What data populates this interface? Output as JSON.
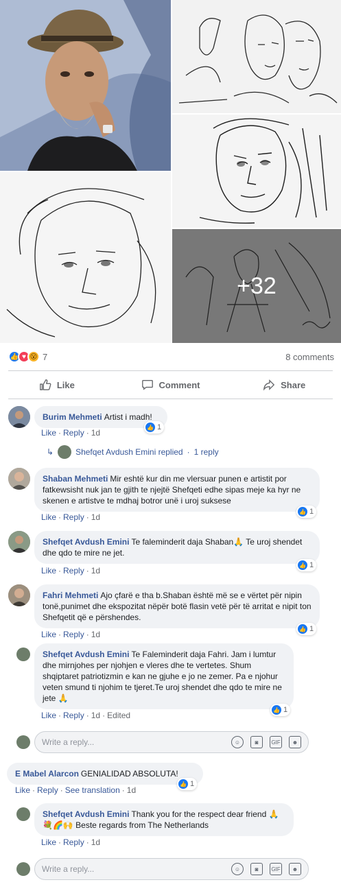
{
  "grid": {
    "more_count": "+32"
  },
  "reactions": {
    "count": "7",
    "comments": "8 comments",
    "icons": [
      "like",
      "love",
      "wow"
    ]
  },
  "actions": {
    "like": "Like",
    "comment": "Comment",
    "share": "Share"
  },
  "comments": [
    {
      "author": "Burim Mehmeti",
      "text": "Artist i madh!",
      "like": "Like",
      "reply": "Reply",
      "time": "1d",
      "reactions": "1"
    },
    {
      "replied_by": "Shefqet Avdush Emini replied",
      "replies": "1 reply"
    },
    {
      "author": "Shaban Mehmeti",
      "text": "Mir eshtë kur din me vlersuar punen e artistit por fatkewsisht nuk jan te gjith te njejtë Shefqeti edhe sipas meje ka hyr ne skenen e artistve te mdhaj botror unë i uroj suksese",
      "like": "Like",
      "reply": "Reply",
      "time": "1d",
      "reactions": "1"
    },
    {
      "author": "Shefqet Avdush Emini",
      "text": "Te faleminderit daja Shaban🙏 Te uroj shendet dhe qdo te mire ne jet.",
      "like": "Like",
      "reply": "Reply",
      "time": "1d",
      "reactions": "1"
    },
    {
      "author": "Fahri Mehmeti",
      "text": "Ajo çfarë e tha b.Shaban është më se e vërtet për nipin tonë,punimet dhe ekspozitat nëpër botë flasin vetë për të arritat e nipit ton Shefqetit që e përshendes.",
      "like": "Like",
      "reply": "Reply",
      "time": "1d",
      "reactions": "1"
    },
    {
      "author": "Shefqet Avdush Emini",
      "text": "Te Faleminderit daja Fahri. Jam i lumtur dhe mirnjohes per njohjen e vleres dhe te vertetes. Shum shqiptaret patriotizmin e kan ne gjuhe e jo ne zemer. Pa e njohur veten smund ti njohim te tjeret.Te uroj shendet dhe qdo te mire ne jete 🙏",
      "like": "Like",
      "reply": "Reply",
      "time": "1d",
      "edited": "Edited",
      "reactions": "1"
    },
    {
      "author": "E Mabel Alarcon",
      "text": "GENIALIDAD ABSOLUTA!",
      "like": "Like",
      "reply": "Reply",
      "translate": "See translation",
      "time": "1d",
      "reactions": "1"
    },
    {
      "author": "Shefqet Avdush Emini",
      "text": "Thank you for the respect dear friend 🙏💐🌈🙌 Beste regards from The Netherlands",
      "like": "Like",
      "reply": "Reply",
      "time": "1d"
    }
  ],
  "reply_box": {
    "placeholder": "Write a reply...",
    "icons": [
      "emoji-icon",
      "camera-icon",
      "gif-icon",
      "sticker-icon"
    ]
  }
}
